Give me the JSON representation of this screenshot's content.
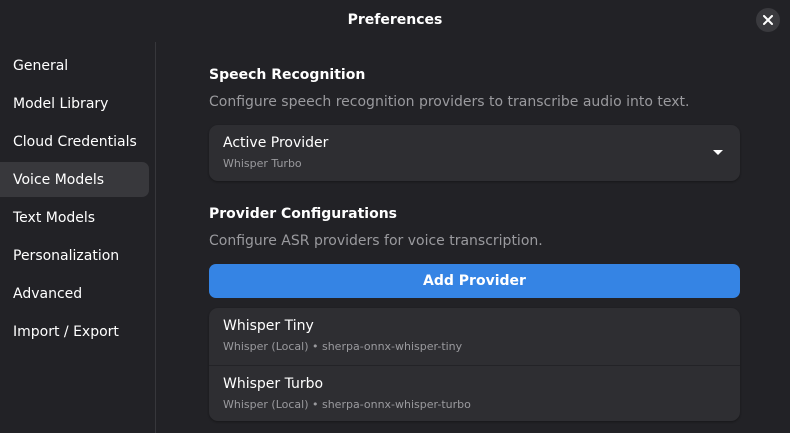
{
  "window": {
    "title": "Preferences"
  },
  "sidebar": {
    "items": [
      {
        "label": "General"
      },
      {
        "label": "Model Library"
      },
      {
        "label": "Cloud Credentials"
      },
      {
        "label": "Voice Models",
        "active": true
      },
      {
        "label": "Text Models"
      },
      {
        "label": "Personalization"
      },
      {
        "label": "Advanced"
      },
      {
        "label": "Import / Export"
      }
    ]
  },
  "speech": {
    "title": "Speech Recognition",
    "description": "Configure speech recognition providers to transcribe audio into text.",
    "active_provider": {
      "label": "Active Provider",
      "value": "Whisper Turbo"
    }
  },
  "providers": {
    "title": "Provider Configurations",
    "description": "Configure ASR providers for voice transcription.",
    "add_label": "Add Provider",
    "items": [
      {
        "name": "Whisper Tiny",
        "detail": "Whisper (Local) • sherpa-onnx-whisper-tiny"
      },
      {
        "name": "Whisper Turbo",
        "detail": "Whisper (Local) • sherpa-onnx-whisper-turbo"
      }
    ]
  },
  "colors": {
    "background": "#222226",
    "card": "#2e2e32",
    "accent": "#3584e4",
    "sidebar_active": "#38383c",
    "dim_text": "#9a9a9e"
  },
  "icons": {
    "close": "close-icon",
    "dropdown": "chevron-down-icon"
  }
}
